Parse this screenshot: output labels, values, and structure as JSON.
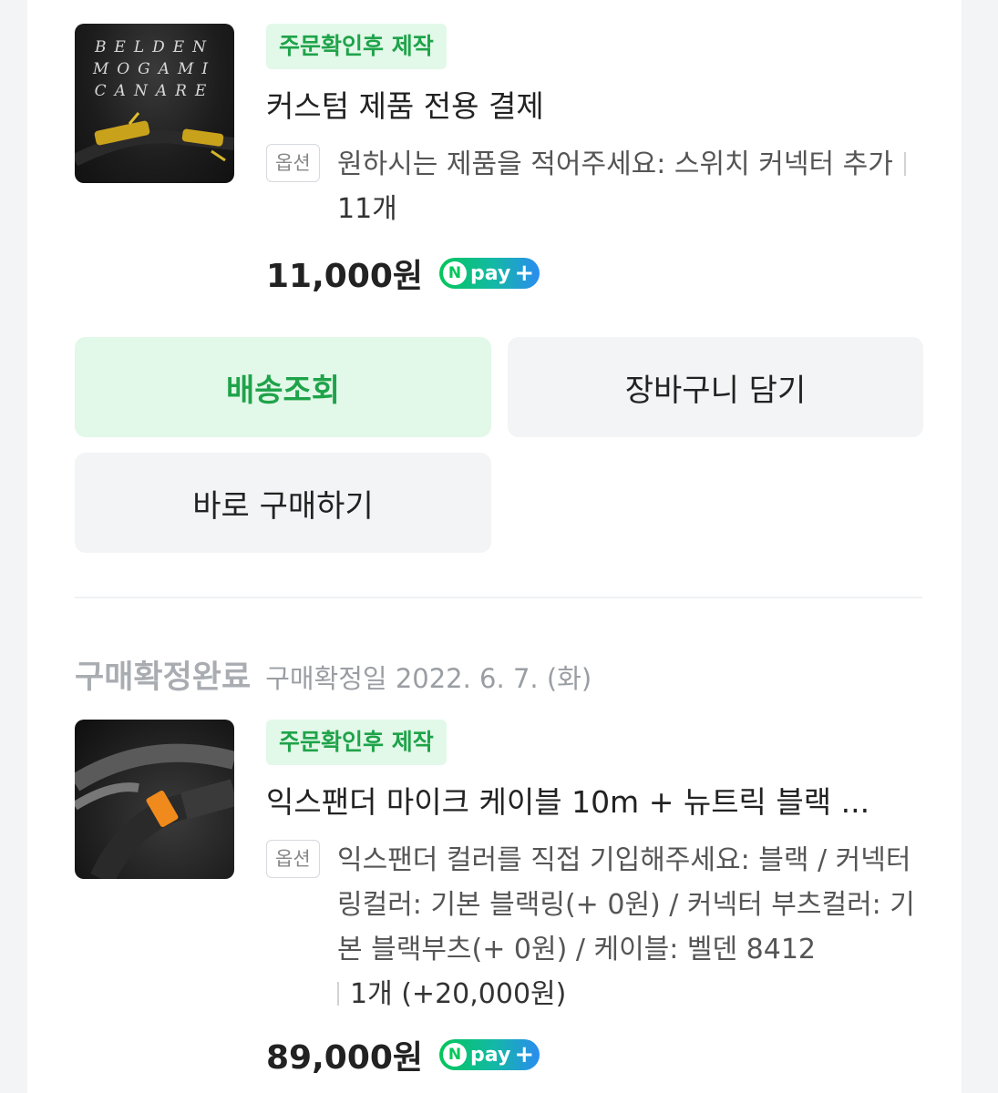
{
  "orders": [
    {
      "tag": "주문확인후 제작",
      "thumb_text": [
        "BELDEN",
        "MOGAMI",
        "CANARE"
      ],
      "title": "커스텀 제품 전용 결제",
      "option_label": "옵션",
      "option_text": "원하시는 제품을 적어주세요: 스위치 커넥터 추가",
      "quantity": "11개",
      "price": "11,000원",
      "npay": "pay"
    },
    {
      "status": "구매확정완료",
      "status_date": "구매확정일 2022. 6. 7. (화)",
      "tag": "주문확인후 제작",
      "title": "익스팬더 마이크 케이블 10m + 뉴트릭 블랙 ...",
      "option_label": "옵션",
      "option_text": "익스팬더 컬러를 직접 기입해주세요: 블랙 / 커넥터 링컬러: 기본 블랙링(+ 0원) / 커넥터 부츠컬러: 기본 블랙부츠(+ 0원) / 케이블: 벨덴 8412",
      "quantity": "1개 (+20,000원)",
      "price": "89,000원",
      "npay": "pay"
    }
  ],
  "buttons": {
    "track_delivery": "배송조회",
    "add_to_cart": "장바구니 담기",
    "buy_now": "바로 구매하기"
  },
  "colors": {
    "accent_green": "#1fa34a",
    "tag_bg": "#e2f8e8",
    "npay_green": "#03c75a"
  }
}
